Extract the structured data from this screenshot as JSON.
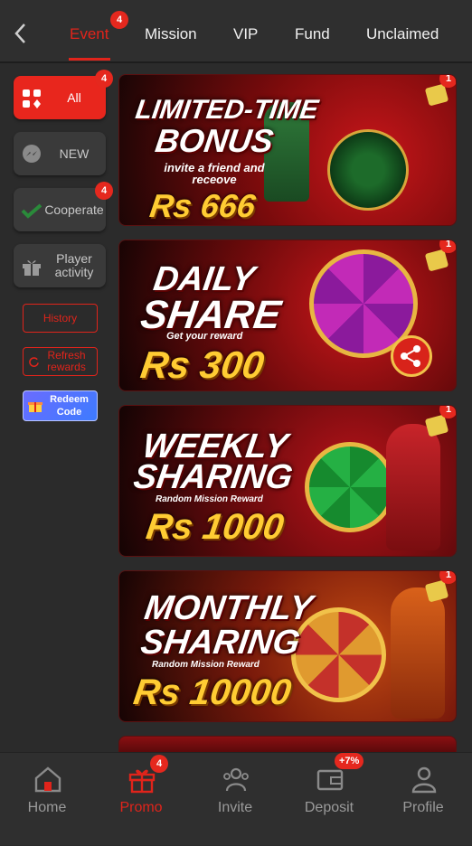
{
  "header": {
    "tabs": [
      {
        "label": "Event",
        "active": true,
        "badge": "4"
      },
      {
        "label": "Mission"
      },
      {
        "label": "VIP"
      },
      {
        "label": "Fund"
      },
      {
        "label": "Unclaimed"
      }
    ]
  },
  "sidebar": {
    "items": [
      {
        "label": "All",
        "badge": "4",
        "icon": "grid-icon",
        "active": true
      },
      {
        "label": "NEW",
        "icon": "messenger-icon"
      },
      {
        "label": "Cooperate",
        "badge": "4",
        "icon": "handshake-icon"
      },
      {
        "label": "Player activity",
        "icon": "gift-icon"
      }
    ],
    "history_label": "History",
    "refresh_label": "Refresh rewards",
    "redeem_label": "Redeem Code"
  },
  "banners": [
    {
      "title1": "LIMITED-TIME",
      "title2": "BONUS",
      "sub": "invite a friend and receove",
      "amount": "Rs 666",
      "badge": "1"
    },
    {
      "title1": "DAILY",
      "title2": "SHARE",
      "sub": "Get your reward",
      "amount": "Rs 300",
      "badge": "1"
    },
    {
      "title1": "WEEKLY",
      "title2": "SHARING",
      "sub": "Random Mission Reward",
      "amount": "Rs 1000",
      "badge": "1"
    },
    {
      "title1": "MONTHLY",
      "title2": "SHARING",
      "sub": "Random Mission Reward",
      "amount": "Rs 10000",
      "badge": "1"
    }
  ],
  "bottom_nav": [
    {
      "label": "Home",
      "icon": "home-icon"
    },
    {
      "label": "Promo",
      "icon": "gift-icon",
      "active": true,
      "badge": "4"
    },
    {
      "label": "Invite",
      "icon": "invite-icon"
    },
    {
      "label": "Deposit",
      "icon": "wallet-icon",
      "badge": "+7%"
    },
    {
      "label": "Profile",
      "icon": "user-icon"
    }
  ],
  "colors": {
    "accent": "#e0241b",
    "background": "#2b2b2b",
    "gold": "#ffcc33"
  }
}
